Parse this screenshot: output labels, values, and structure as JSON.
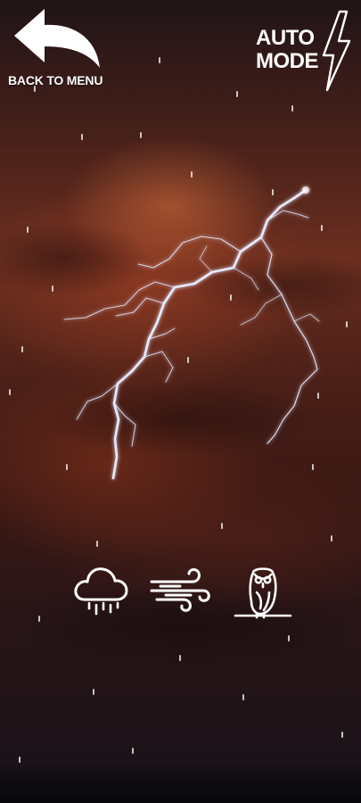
{
  "header": {
    "back_label": "BACK TO MENU",
    "auto_line1": "AUTO",
    "auto_line2": "MODE"
  },
  "icons": {
    "back": "back-arrow-icon",
    "auto": "lightning-bolt-icon",
    "sounds": [
      "rain-cloud-icon",
      "wind-icon",
      "owl-icon"
    ]
  },
  "colors": {
    "icon": "#ffffff",
    "lightning": "#e6e8ff"
  }
}
